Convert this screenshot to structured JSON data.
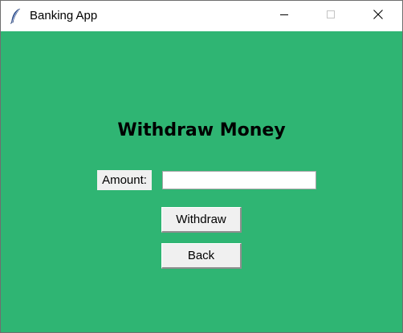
{
  "window": {
    "title": "Banking App",
    "app_icon": "feather-icon",
    "controls": [
      "minimize-icon",
      "maximize-icon",
      "close-icon"
    ]
  },
  "colors": {
    "background": "#2fb573",
    "label_bg": "#f0f0f0",
    "button_bg": "#f0f0f0"
  },
  "form": {
    "heading": "Withdraw Money",
    "amount_label": "Amount:",
    "amount_value": "",
    "withdraw_label": "Withdraw",
    "back_label": "Back"
  }
}
